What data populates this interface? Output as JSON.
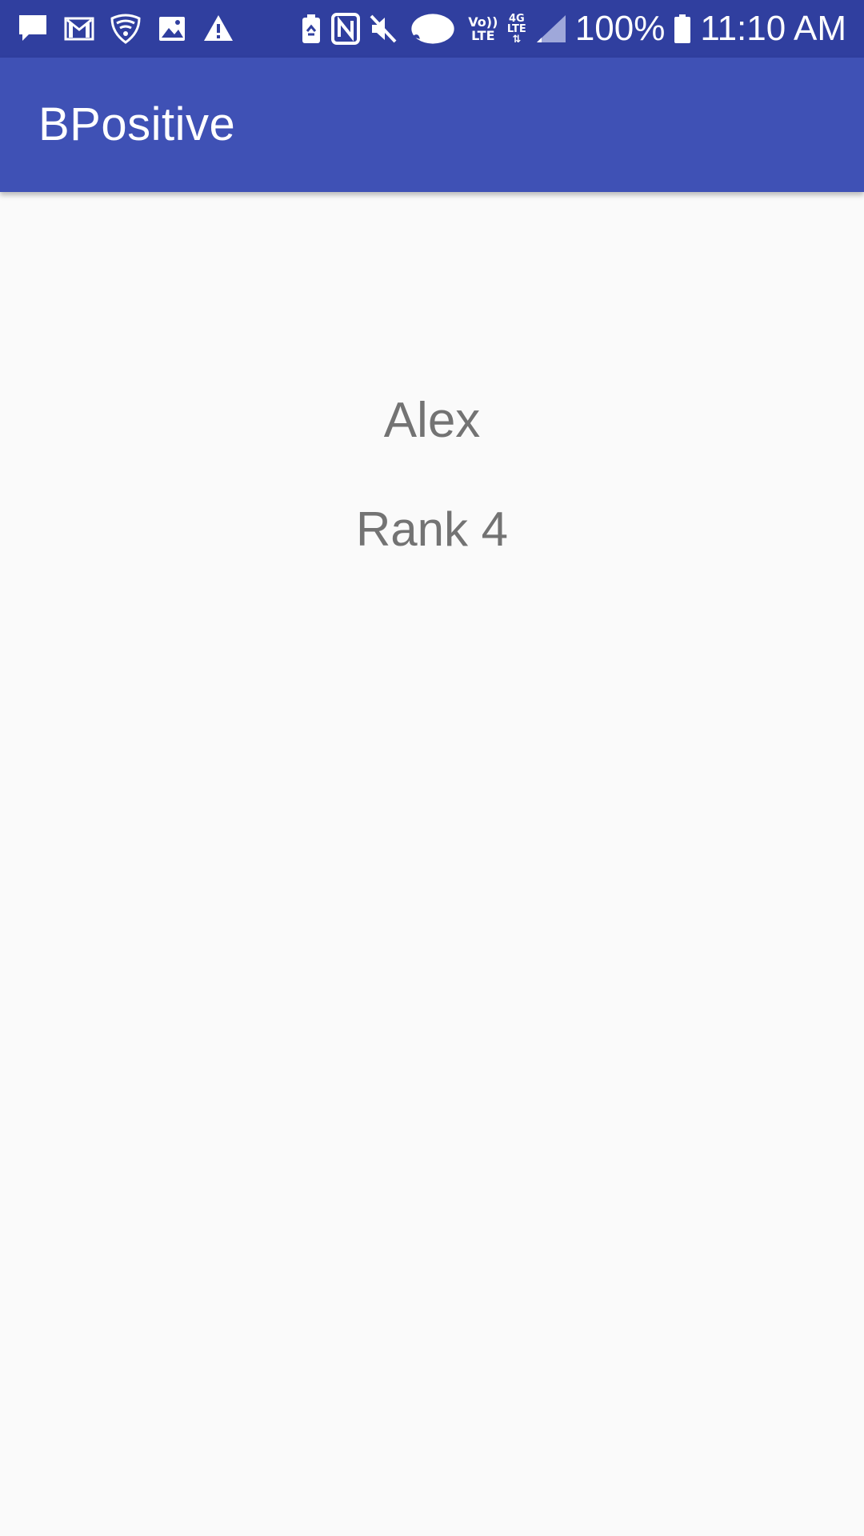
{
  "status_bar": {
    "left_icons": [
      "message-icon",
      "gmail-icon",
      "wifi-shield-icon",
      "image-icon",
      "warning-icon"
    ],
    "right_icons": [
      "battery-saver-icon",
      "nfc-icon",
      "mute-icon",
      "oval-icon",
      "volte-icon",
      "data-4g-icon",
      "signal-icon",
      "battery-icon"
    ],
    "volte_top": "Vo))",
    "volte_bottom": "LTE",
    "network_top": "4G",
    "network_mid": "LTE",
    "battery_percent": "100%",
    "time": "11:10 AM",
    "background_color": "#303f9f"
  },
  "app_bar": {
    "title": "BPositive",
    "background_color": "#3f51b5"
  },
  "main": {
    "name": "Alex",
    "rank": "Rank 4",
    "text_color": "#737373",
    "background_color": "#fafafa"
  }
}
